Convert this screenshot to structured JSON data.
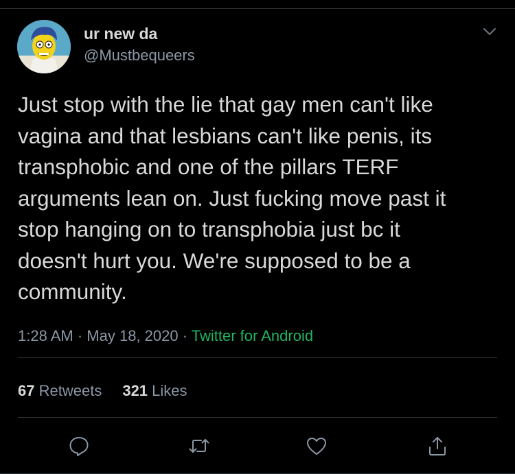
{
  "tweet": {
    "display_name": "ur new da",
    "handle": "@Mustbequeers",
    "text": "Just stop with the lie that gay men can't like\nvagina and that lesbians can't like penis, its\ntransphobic and one of the pillars TERF\narguments lean on. Just fucking move past it\nstop hanging on to transphobia just bc it\ndoesn't hurt you. We're supposed to be a\ncommunity.",
    "time": "1:28 AM",
    "separator": "·",
    "date": "May 18, 2020",
    "source": "Twitter for Android"
  },
  "stats": {
    "retweets_count": "67",
    "retweets_label": "Retweets",
    "likes_count": "321",
    "likes_label": "Likes"
  },
  "icons": {
    "more": "chevron-down-icon",
    "reply": "reply-icon",
    "retweet": "retweet-icon",
    "like": "heart-icon",
    "share": "share-icon"
  },
  "colors": {
    "background": "#000000",
    "text": "#d9d9d9",
    "secondary": "#8b98a5",
    "source_link": "#21b561",
    "divider": "#2f3336"
  }
}
